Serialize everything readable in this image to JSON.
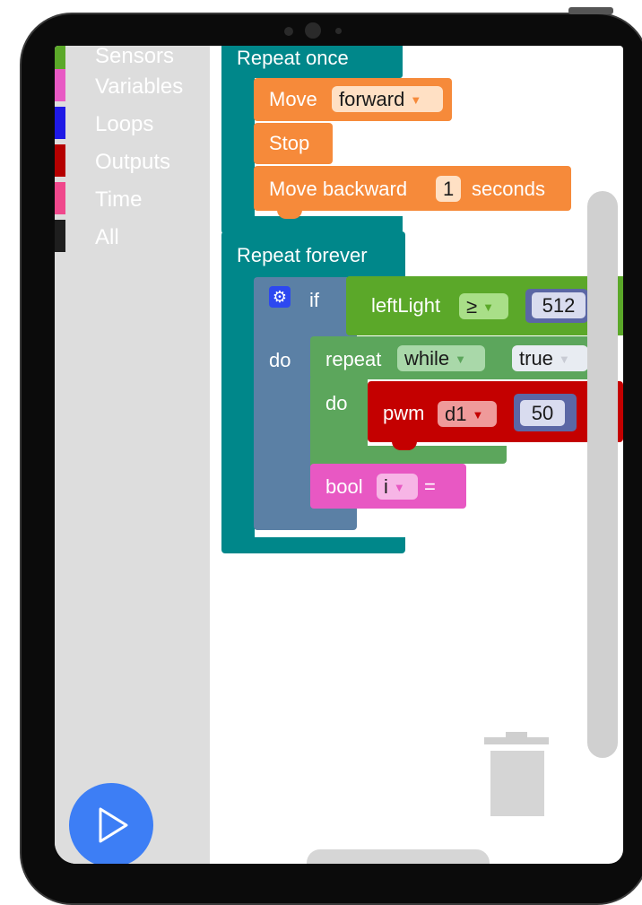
{
  "sidebar": {
    "categories": [
      {
        "label": "Sensors",
        "color": "#5ba829"
      },
      {
        "label": "Variables",
        "color": "#e859c4"
      },
      {
        "label": "Loops",
        "color": "#1e19e6"
      },
      {
        "label": "Outputs",
        "color": "#b50000"
      },
      {
        "label": "Time",
        "color": "#f0488c"
      },
      {
        "label": "All",
        "color": "#1e1e1e"
      }
    ]
  },
  "workspace": {
    "repeat_once": {
      "label": "Repeat once",
      "move": {
        "label": "Move",
        "direction": "forward"
      },
      "stop": {
        "label": "Stop"
      },
      "move_backward": {
        "label": "Move backward",
        "value": "1",
        "unit": "seconds"
      }
    },
    "repeat_forever": {
      "label": "Repeat forever",
      "if_block": {
        "if_label": "if",
        "do_label": "do",
        "condition": {
          "variable": "leftLight",
          "operator": "≥",
          "value": "512"
        },
        "repeat": {
          "label": "repeat",
          "mode": "while",
          "condition": "true",
          "do_label": "do"
        },
        "pwm": {
          "label": "pwm",
          "pin": "d1",
          "value": "50"
        },
        "bool": {
          "label": "bool",
          "variable": "i",
          "op": "="
        }
      }
    }
  },
  "colors": {
    "loop_teal": "#00878a",
    "motion_orange": "#f68a3a",
    "logic_blue": "#5b80a5",
    "logic_green": "#5ba829",
    "loops_green": "#5ca65c",
    "output_red": "#c40000",
    "variable_pink": "#e858c3",
    "math_purple": "#5b67a5",
    "run_button": "#3d7ef5"
  },
  "icons": {
    "gear": "gear-icon",
    "trash": "trash-icon",
    "play": "play-icon"
  }
}
